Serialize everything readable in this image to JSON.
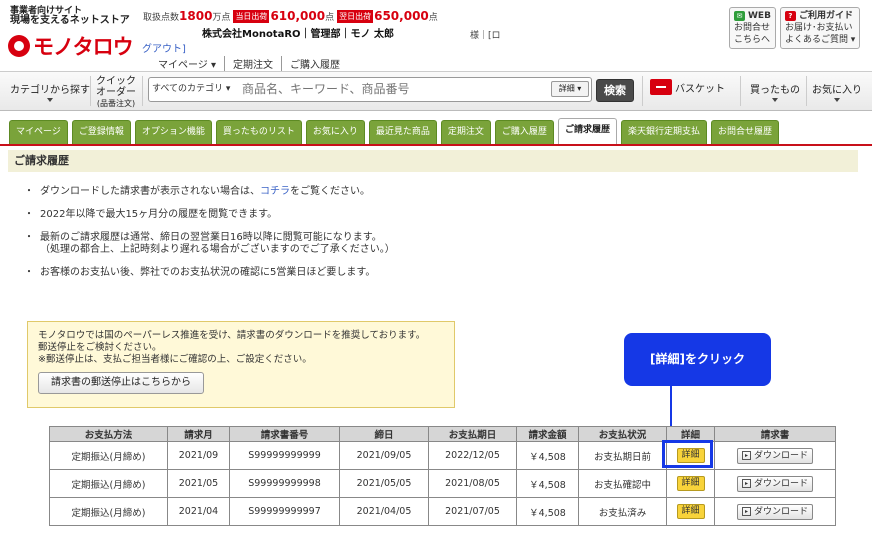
{
  "header": {
    "tagline_top": "事業者向けサイト",
    "tagline_bottom": "現場を支えるネットストア",
    "logo_text": "モノタロウ",
    "logout_text": "グアウト]",
    "stats": {
      "label": "取扱点数",
      "total": "1800",
      "total_unit": "万点",
      "today_tag": "当日出荷",
      "today": "610,000",
      "today_unit": "点",
      "next_tag": "翌日出荷",
      "next": "650,000",
      "next_unit": "点"
    },
    "company": "株式会社MonotaRO｜管理部｜モノ 太郎",
    "sama": "様｜[ロ",
    "my_menu": [
      "マイページ ▾",
      "定期注文",
      "ご購入履歴"
    ],
    "web_inquiry": {
      "title": "WEB",
      "line1": "お問合せ",
      "line2": "こちらへ"
    },
    "guide": {
      "title": "ご利用ガイド",
      "line1": "お届け･お支払い",
      "line2": "よくあるご質問 ▾"
    }
  },
  "searchbar": {
    "category_label": "カテゴリから探す",
    "quick_order_line1": "クイック",
    "quick_order_line2": "オーダー",
    "quick_order_line3": "(品番注文)",
    "category_select": "すべてのカテゴリ ▾",
    "placeholder": "商品名、キーワード、商品番号",
    "detail_label": "詳細 ▾",
    "search_button": "検索",
    "basket_label": "バスケット",
    "purchased_label": "買ったもの",
    "favorite_label": "お気に入り"
  },
  "tabs": [
    "マイページ",
    "ご登録情報",
    "オプション機能",
    "買ったものリスト",
    "お気に入り",
    "最近見た商品",
    "定期注文",
    "ご購入履歴",
    "ご請求履歴",
    "楽天銀行定期支払",
    "お問合せ履歴"
  ],
  "active_tab": "ご請求履歴",
  "page_title": "ご請求履歴",
  "bullets": {
    "b1_pre": "ダウンロードした請求書が表示されない場合は、",
    "b1_link": "コチラ",
    "b1_post": "をご覧ください。",
    "b2": "2022年以降で最大15ヶ月分の履歴を閲覧できます。",
    "b3_line1": "最新のご請求履歴は通常、締日の翌営業日16時以降に閲覧可能になります。",
    "b3_line2": "（処理の都合上、上記時刻より遅れる場合がございますのでご了承ください。）",
    "b4": "お客様のお支払い後、弊社でのお支払状況の確認に5営業日ほど要します。"
  },
  "notice": {
    "line1": "モノタロウでは国のペーパーレス推進を受け、請求書のダウンロードを推奨しております。",
    "line2": "郵送停止をご検討ください。",
    "line3": "※郵送停止は、支払ご担当者様にご確認の上、ご設定ください。",
    "button": "請求書の郵送停止はこちらから"
  },
  "callout": "[詳細]をクリック",
  "table": {
    "headers": [
      "お支払方法",
      "請求月",
      "請求書番号",
      "締日",
      "お支払期日",
      "請求金額",
      "お支払状況",
      "詳細",
      "請求書"
    ],
    "rows": [
      {
        "method": "定期振込(月締め)",
        "month": "2021/09",
        "number": "S99999999999",
        "close": "2021/09/05",
        "due": "2022/12/05",
        "amount": "￥4,508",
        "status": "お支払期日前",
        "detail": "詳細",
        "download": "ダウンロード"
      },
      {
        "method": "定期振込(月締め)",
        "month": "2021/05",
        "number": "S99999999998",
        "close": "2021/05/05",
        "due": "2021/08/05",
        "amount": "￥4,508",
        "status": "お支払確認中",
        "detail": "詳細",
        "download": "ダウンロード"
      },
      {
        "method": "定期振込(月締め)",
        "month": "2021/04",
        "number": "S99999999997",
        "close": "2021/04/05",
        "due": "2021/07/05",
        "amount": "￥4,508",
        "status": "お支払済み",
        "detail": "詳細",
        "download": "ダウンロード"
      }
    ]
  }
}
